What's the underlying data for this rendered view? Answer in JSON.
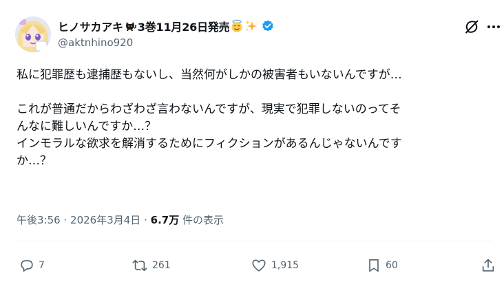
{
  "author": {
    "display_name": "ヒノサカアキ",
    "name_suffix": "3巻11月26日発売",
    "handle": "@aktnhino920",
    "name_icons": [
      "black-cat-emoji",
      "smiling-face-with-halo-emoji",
      "sparkles-emoji",
      "verified-badge-icon"
    ]
  },
  "tweet": {
    "lines": [
      "私に犯罪歴も逮捕歴もないし、当然何がしかの被害者もいないんですが…",
      "",
      "これが普通だからわざわざ言わないんですが、現実で犯罪しないのってそ",
      "んなに難しいんですか…？",
      "インモラルな欲求を解消するためにフィクションがあるんじゃないんです",
      "か…？"
    ]
  },
  "meta": {
    "time": "午後3:56",
    "separator": "·",
    "date": "2026年3月4日",
    "views_count": "6.7万",
    "views_label": "件の表示"
  },
  "actions": {
    "replies": "7",
    "retweets": "261",
    "likes": "1,915",
    "bookmarks": "60"
  },
  "colors": {
    "text_primary": "#0f1419",
    "text_secondary": "#536471",
    "verified_blue": "#1d9bf0",
    "divider": "#eff3f4"
  }
}
